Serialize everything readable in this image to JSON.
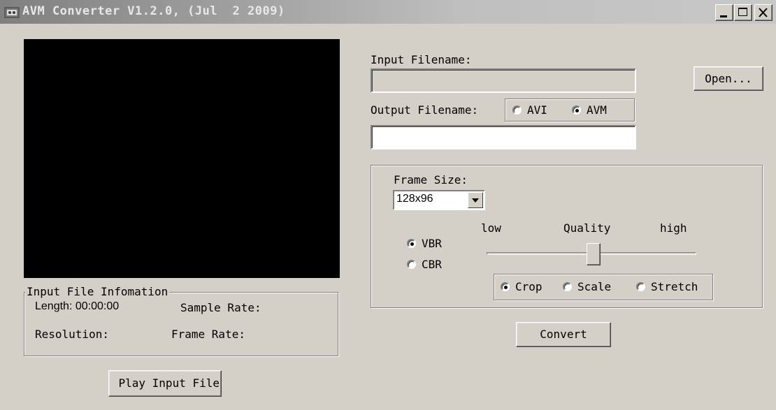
{
  "window": {
    "title": "AVM Converter V1.2.0, (Jul  2 2009)",
    "controls": {
      "minimize": "_",
      "maximize": "□",
      "close": "x"
    }
  },
  "files": {
    "input_label": "Input Filename:",
    "input_value": "",
    "open_button": "Open...",
    "output_label": "Output Filename:",
    "output_value": "",
    "format_options": [
      "AVI",
      "AVM"
    ],
    "format_selected": "AVM"
  },
  "settings": {
    "frame_size_label": "Frame Size:",
    "frame_size_value": "128x96",
    "bitrate_options": [
      "VBR",
      "CBR"
    ],
    "bitrate_selected": "VBR",
    "quality": {
      "low_label": "low",
      "title": "Quality",
      "high_label": "high",
      "value_fraction": 0.51
    },
    "fit_options": [
      "Crop",
      "Scale",
      "Stretch"
    ],
    "fit_selected": "Crop"
  },
  "info": {
    "group_title": "Input File Infomation",
    "length_label": "Length: 00:00:00",
    "sample_rate_label": "Sample Rate:",
    "resolution_label": "Resolution:",
    "frame_rate_label": "Frame Rate:"
  },
  "actions": {
    "convert": "Convert",
    "play_input": "Play Input File"
  }
}
